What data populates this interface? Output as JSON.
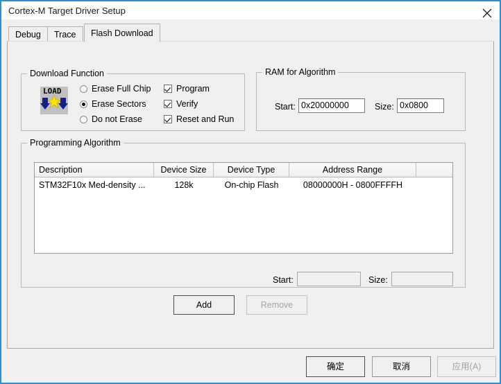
{
  "window": {
    "title": "Cortex-M Target Driver Setup",
    "close_icon": "close-icon",
    "border_color": "#2a8fd6"
  },
  "tabs": [
    {
      "label": "Debug",
      "selected": false
    },
    {
      "label": "Trace",
      "selected": false
    },
    {
      "label": "Flash Download",
      "selected": true
    }
  ],
  "download_function": {
    "legend": "Download Function",
    "icon_label": "LOAD",
    "erase_options": [
      {
        "label": "Erase Full Chip",
        "selected": false
      },
      {
        "label": "Erase Sectors",
        "selected": true
      },
      {
        "label": "Do not Erase",
        "selected": false
      }
    ],
    "checkboxes": [
      {
        "label": "Program",
        "checked": true
      },
      {
        "label": "Verify",
        "checked": true
      },
      {
        "label": "Reset and Run",
        "checked": true
      }
    ]
  },
  "ram_for_algorithm": {
    "legend": "RAM for Algorithm",
    "start_label": "Start:",
    "start_value": "0x20000000",
    "size_label": "Size:",
    "size_value": "0x0800"
  },
  "programming_algorithm": {
    "legend": "Programming Algorithm",
    "columns": [
      "Description",
      "Device Size",
      "Device Type",
      "Address Range",
      ""
    ],
    "rows": [
      {
        "description": "STM32F10x Med-density ...",
        "device_size": "128k",
        "device_type": "On-chip Flash",
        "address_range": "08000000H - 0800FFFFH"
      }
    ],
    "start_label": "Start:",
    "start_value": "",
    "size_label": "Size:",
    "size_value": "",
    "add_button": "Add",
    "remove_button": "Remove"
  },
  "footer": {
    "ok_button": "确定",
    "cancel_button": "取消",
    "apply_button": "应用(A)"
  }
}
